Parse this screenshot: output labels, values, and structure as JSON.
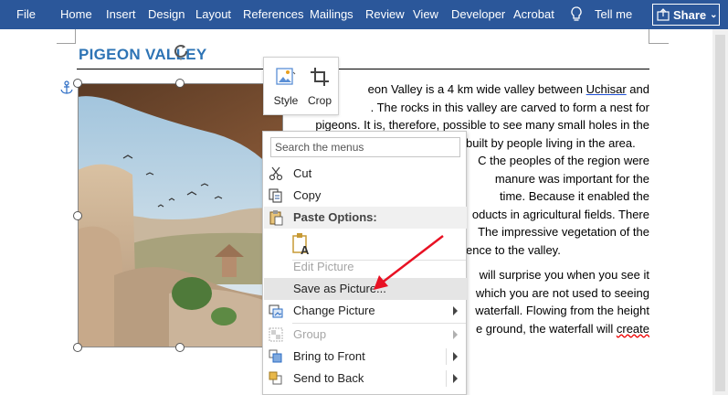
{
  "ribbon": {
    "tabs": [
      "File",
      "Home",
      "Insert",
      "Design",
      "Layout",
      "References",
      "Mailings",
      "Review",
      "View",
      "Developer",
      "Acrobat"
    ],
    "tell_me": "Tell me",
    "share_label": "Share",
    "bg_color": "#2b579a"
  },
  "document": {
    "heading": "PIGEON VALLEY",
    "heading_color": "#2e74b5",
    "para1_lines": [
      "Pigeon Valley is a 4 km wide valley between Uchisar and",
      "Göreme. The rocks in this valley are carved to form a nest for",
      "pigeons. It is, therefore, possible to see many small holes in the",
      "rocks, built by people living in the area.",
      "Since 2000 BC the peoples of the region were",
      "aware that the manure was important for the",
      "agriculture of the time. Because it enabled the",
      "cultivation of products in agricultural fields. There",
      "are many holes. The impressive vegetation of the",
      "valley gives a difference to the valley."
    ],
    "para1_visible": [
      "eon Valley is a 4 km wide valley between ",
      ". The rocks in this valley are carved to form a nest for",
      "pigeons. It is, therefore, possible to see many small holes in the",
      "built by people living in the area.",
      "C the peoples of the region were",
      "manure was important for the",
      "time. Because it enabled the",
      "oducts in agricultural fields. There",
      "The impressive vegetation of the",
      "ence to the valley."
    ],
    "uchisar": "Uchisar",
    "and": " and",
    "para2_visible": [
      "will surprise you when you see it",
      "which you are not used to seeing",
      "waterfall. Flowing from the height",
      "e ground, the waterfall will ",
      "create"
    ]
  },
  "mini_toolbar": {
    "style_label": "Style",
    "crop_label": "Crop"
  },
  "context_menu": {
    "search_placeholder": "Search the menus",
    "cut": "Cut",
    "copy": "Copy",
    "paste_options": "Paste Options:",
    "edit_picture": "Edit Picture",
    "save_as_picture": "Save as Picture...",
    "change_picture": "Change Picture",
    "group": "Group",
    "bring_to_front": "Bring to Front",
    "send_to_back": "Send to Back"
  },
  "colors": {
    "highlight": "#e5e5e5",
    "arrow": "#e81123",
    "disabled": "#a6a6a6"
  },
  "icons": [
    "lightbulb-icon",
    "share-icon",
    "anchor-icon",
    "rotate-icon",
    "style-icon",
    "crop-icon",
    "scissors-icon",
    "copy-icon",
    "paste-icon",
    "paste-picture-icon",
    "change-picture-icon",
    "group-icon",
    "bring-front-icon",
    "send-back-icon"
  ]
}
